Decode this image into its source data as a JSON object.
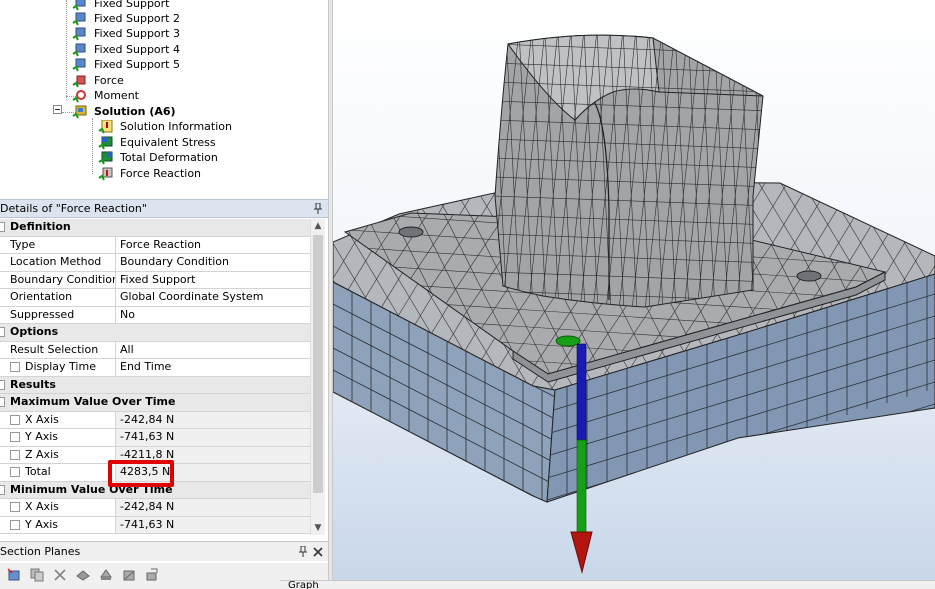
{
  "tree": {
    "items": [
      {
        "label": "Fixed Support"
      },
      {
        "label": "Fixed Support 2"
      },
      {
        "label": "Fixed Support 3"
      },
      {
        "label": "Fixed Support 4"
      },
      {
        "label": "Fixed Support 5"
      },
      {
        "label": "Force"
      },
      {
        "label": "Moment"
      },
      {
        "label": "Solution (A6)"
      },
      {
        "label": "Solution Information"
      },
      {
        "label": "Equivalent Stress"
      },
      {
        "label": "Total Deformation"
      },
      {
        "label": "Force Reaction"
      }
    ]
  },
  "details": {
    "title": "Details of \"Force Reaction\"",
    "groups": {
      "definition": "Definition",
      "options": "Options",
      "results": "Results",
      "max_over_time": "Maximum Value Over Time",
      "min_over_time": "Minimum Value Over Time"
    },
    "rows": {
      "type": {
        "label": "Type",
        "value": "Force Reaction"
      },
      "location_method": {
        "label": "Location Method",
        "value": "Boundary Condition"
      },
      "boundary_condition": {
        "label": "Boundary Condition",
        "value": "Fixed Support"
      },
      "orientation": {
        "label": "Orientation",
        "value": "Global Coordinate System"
      },
      "suppressed": {
        "label": "Suppressed",
        "value": "No"
      },
      "result_selection": {
        "label": "Result Selection",
        "value": "All"
      },
      "display_time": {
        "label": "Display Time",
        "value": "End Time"
      },
      "max_x": {
        "label": "X Axis",
        "value": "-242,84 N"
      },
      "max_y": {
        "label": "Y Axis",
        "value": "-741,63 N"
      },
      "max_z": {
        "label": "Z Axis",
        "value": "-4211,8 N"
      },
      "max_total": {
        "label": "Total",
        "value": "4283,5 N"
      },
      "min_x": {
        "label": "X Axis",
        "value": "-242,84 N"
      },
      "min_y": {
        "label": "Y Axis",
        "value": "-741,63 N"
      }
    }
  },
  "section_planes": {
    "title": "Section Planes"
  },
  "graph_tab": {
    "label": "Graph"
  },
  "colors": {
    "highlight": "#e10000",
    "header_bg": "#dbe4ef",
    "mesh_fill": "#a4a6aa",
    "mesh_blue": "#8a9fb8"
  },
  "icons": [
    "fixed-support-icon",
    "force-icon",
    "moment-icon",
    "solution-icon",
    "solution-information-icon",
    "equivalent-stress-icon",
    "total-deformation-icon",
    "force-reaction-icon",
    "pin-icon",
    "close-icon"
  ]
}
